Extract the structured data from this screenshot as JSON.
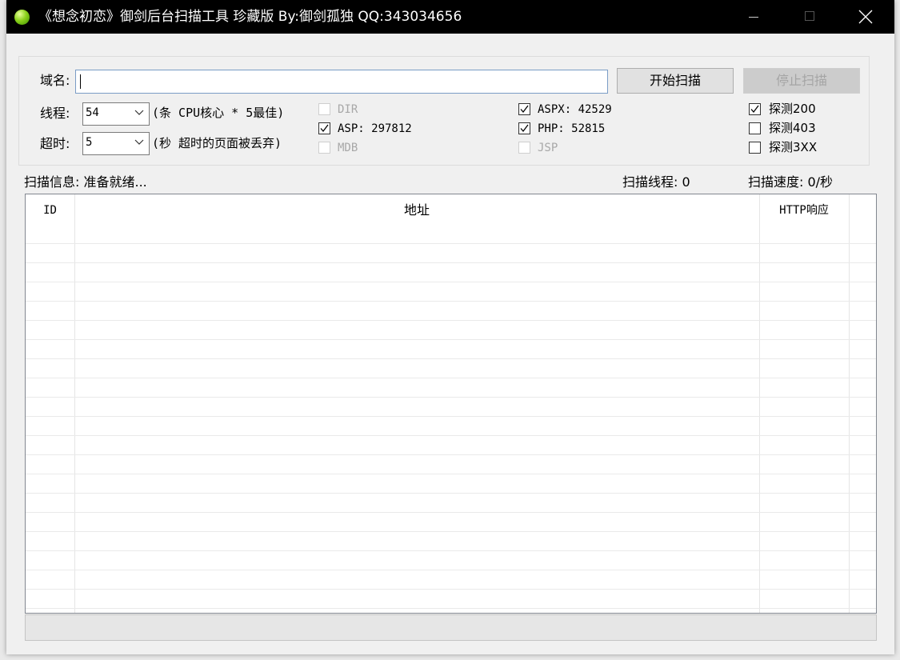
{
  "window": {
    "title": "《想念初恋》御剑后台扫描工具 珍藏版 By:御剑孤独 QQ:343034656"
  },
  "form": {
    "domain_label": "域名:",
    "domain_value": "",
    "threads_label": "线程:",
    "threads_value": "54",
    "threads_hint": "(条 CPU核心 * 5最佳)",
    "timeout_label": "超时:",
    "timeout_value": "5",
    "timeout_hint": "(秒 超时的页面被丢弃)",
    "start_button": "开始扫描",
    "stop_button": "停止扫描"
  },
  "dict_options": [
    {
      "label": "DIR",
      "checked": false,
      "enabled": false
    },
    {
      "label": "ASP: 297812",
      "checked": true,
      "enabled": true
    },
    {
      "label": "MDB",
      "checked": false,
      "enabled": false
    },
    {
      "label": "ASPX: 42529",
      "checked": true,
      "enabled": true
    },
    {
      "label": "PHP: 52815",
      "checked": true,
      "enabled": true
    },
    {
      "label": "JSP",
      "checked": false,
      "enabled": false
    }
  ],
  "probe_options": [
    {
      "label": "探测200",
      "checked": true
    },
    {
      "label": "探测403",
      "checked": false
    },
    {
      "label": "探测3XX",
      "checked": false
    }
  ],
  "status": {
    "info": "扫描信息: 准备就绪...",
    "threads": "扫描线程: 0",
    "speed": "扫描速度: 0/秒"
  },
  "table": {
    "columns": [
      "ID",
      "地址",
      "HTTP响应"
    ],
    "rows": []
  }
}
